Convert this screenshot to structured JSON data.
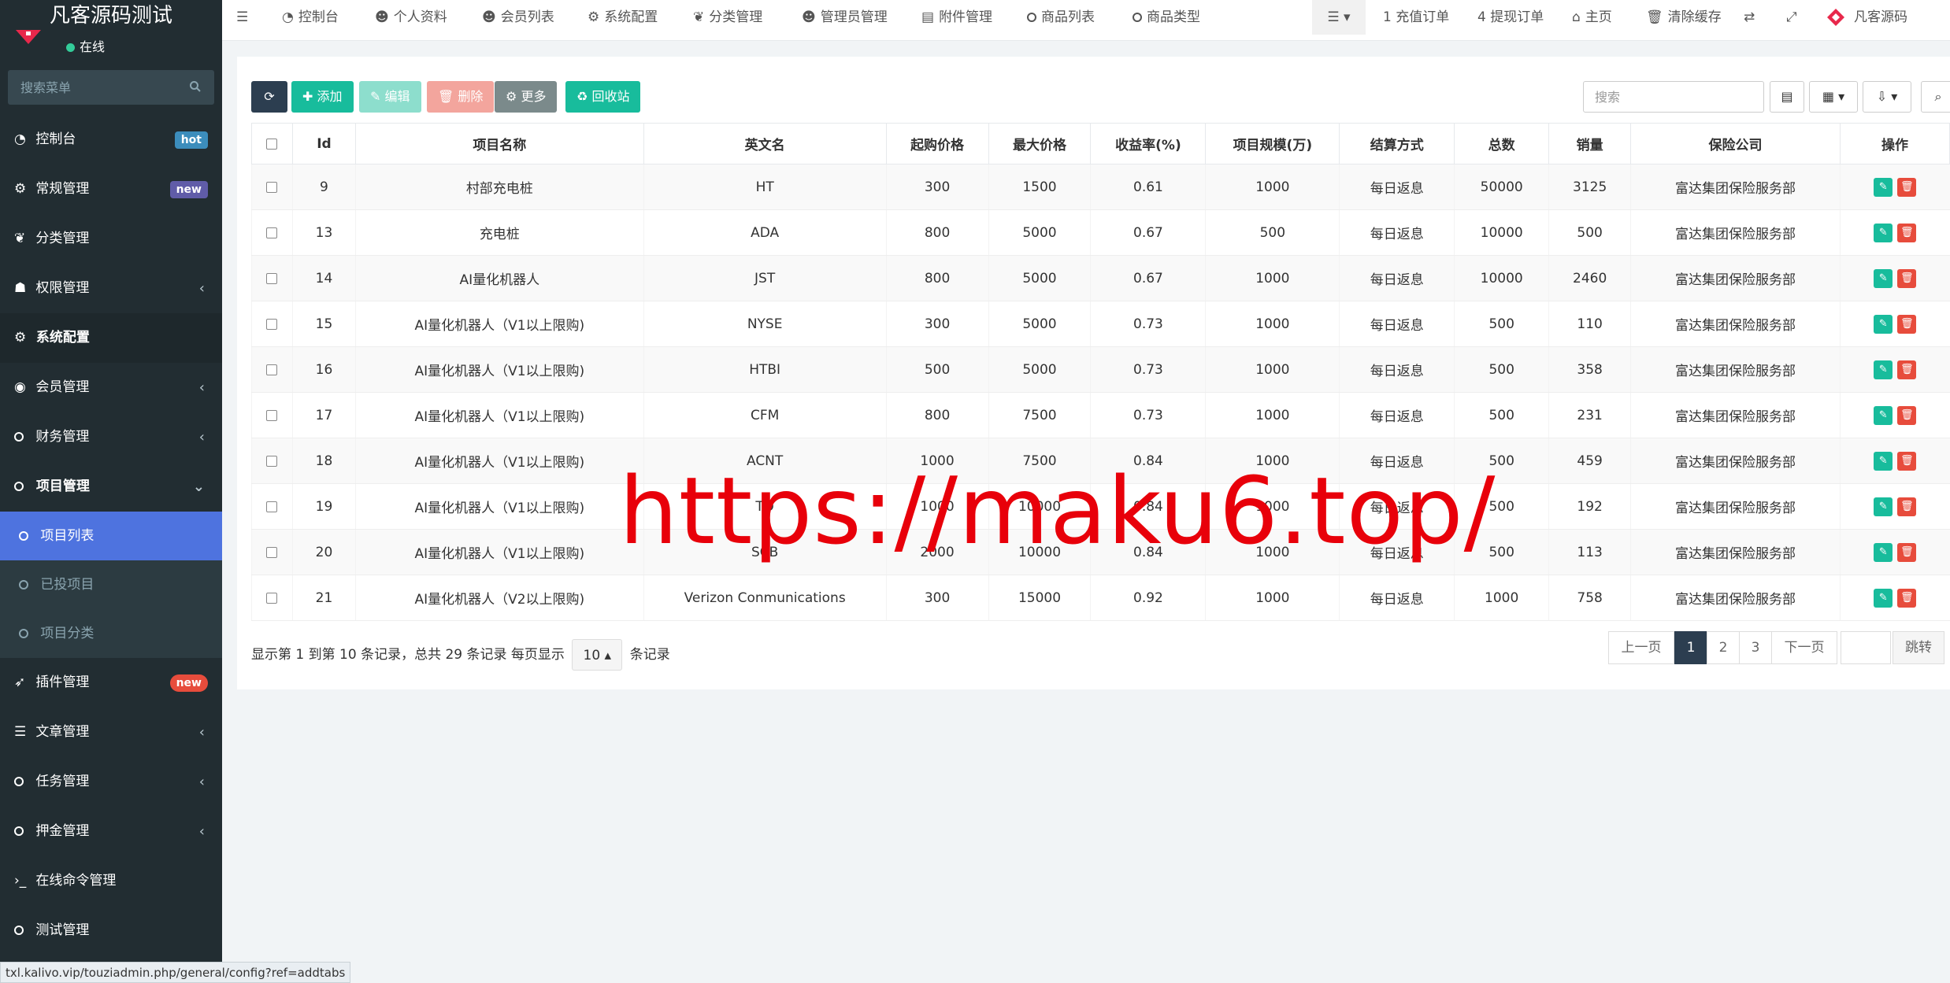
{
  "sidebar": {
    "brand": "凡客源码测试",
    "status": "在线",
    "search_placeholder": "搜索菜单",
    "items": [
      {
        "label": "控制台",
        "badge": "hot"
      },
      {
        "label": "常规管理",
        "badge": "new"
      },
      {
        "label": "分类管理"
      },
      {
        "label": "权限管理",
        "arrow": "‹"
      },
      {
        "label": "系统配置"
      },
      {
        "label": "会员管理",
        "arrow": "‹"
      },
      {
        "label": "财务管理",
        "arrow": "‹"
      },
      {
        "label": "项目管理",
        "arrow": "⌄"
      }
    ],
    "sub_items": [
      {
        "label": "项目列表"
      },
      {
        "label": "已投项目"
      },
      {
        "label": "项目分类"
      }
    ],
    "items_after": [
      {
        "label": "插件管理",
        "badge": "new"
      },
      {
        "label": "文章管理",
        "arrow": "‹"
      },
      {
        "label": "任务管理",
        "arrow": "‹"
      },
      {
        "label": "押金管理",
        "arrow": "‹"
      },
      {
        "label": "在线命令管理"
      },
      {
        "label": "测试管理"
      }
    ]
  },
  "topnav": {
    "tabs": [
      "控制台",
      "个人资料",
      "会员列表",
      "系统配置",
      "分类管理",
      "管理员管理",
      "附件管理",
      "商品列表",
      "商品类型"
    ],
    "right": {
      "recharge": "1 充值订单",
      "withdraw": "4 提现订单",
      "home": "主页",
      "clear_cache": "清除缓存",
      "user": "凡客源码"
    }
  },
  "toolbar": {
    "add": "添加",
    "edit": "编辑",
    "delete": "删除",
    "more": "更多",
    "recycle": "回收站",
    "search_placeholder": "搜索"
  },
  "table": {
    "headers": [
      "Id",
      "项目名称",
      "英文名",
      "起购价格",
      "最大价格",
      "收益率(%)",
      "项目规模(万)",
      "结算方式",
      "总数",
      "销量",
      "保险公司",
      "操作"
    ],
    "rows": [
      [
        "9",
        "村部充电桩",
        "HT",
        "300",
        "1500",
        "0.61",
        "1000",
        "每日返息",
        "50000",
        "3125",
        "富达集团保险服务部"
      ],
      [
        "13",
        "充电桩",
        "ADA",
        "800",
        "5000",
        "0.67",
        "500",
        "每日返息",
        "10000",
        "500",
        "富达集团保险服务部"
      ],
      [
        "14",
        "AI量化机器人",
        "JST",
        "800",
        "5000",
        "0.67",
        "1000",
        "每日返息",
        "10000",
        "2460",
        "富达集团保险服务部"
      ],
      [
        "15",
        "AI量化机器人（V1以上限购)",
        "NYSE",
        "300",
        "5000",
        "0.73",
        "1000",
        "每日返息",
        "500",
        "110",
        "富达集团保险服务部"
      ],
      [
        "16",
        "AI量化机器人（V1以上限购)",
        "HTBI",
        "500",
        "5000",
        "0.73",
        "1000",
        "每日返息",
        "500",
        "358",
        "富达集团保险服务部"
      ],
      [
        "17",
        "AI量化机器人（V1以上限购)",
        "CFM",
        "800",
        "7500",
        "0.73",
        "1000",
        "每日返息",
        "500",
        "231",
        "富达集团保险服务部"
      ],
      [
        "18",
        "AI量化机器人（V1以上限购)",
        "ACNT",
        "1000",
        "7500",
        "0.84",
        "1000",
        "每日返息",
        "500",
        "459",
        "富达集团保险服务部"
      ],
      [
        "19",
        "AI量化机器人（V1以上限购)",
        "TD",
        "1000",
        "10000",
        "0.84",
        "1000",
        "每日返息",
        "500",
        "192",
        "富达集团保险服务部"
      ],
      [
        "20",
        "AI量化机器人（V1以上限购)",
        "SCB",
        "2000",
        "10000",
        "0.84",
        "1000",
        "每日返息",
        "500",
        "113",
        "富达集团保险服务部"
      ],
      [
        "21",
        "AI量化机器人（V2以上限购)",
        "Verizon Conmunications",
        "300",
        "15000",
        "0.92",
        "1000",
        "每日返息",
        "1000",
        "758",
        "富达集团保险服务部"
      ]
    ]
  },
  "pagination": {
    "info_prefix": "显示第 1 到第 10 条记录，总共 29 条记录 每页显示",
    "page_size": "10",
    "info_suffix": "条记录",
    "prev": "上一页",
    "pages": [
      "1",
      "2",
      "3"
    ],
    "next": "下一页",
    "jump": "跳转"
  },
  "watermark": "https://maku6.top/",
  "statusbar_url": "txl.kalivo.vip/touziadmin.php/general/config?ref=addtabs",
  "colors": {
    "sidebar_bg": "#222d32",
    "active_sub": "#4e73df",
    "accent_green": "#18bc9c",
    "danger": "#e74c3c",
    "dark": "#2c3e50"
  }
}
